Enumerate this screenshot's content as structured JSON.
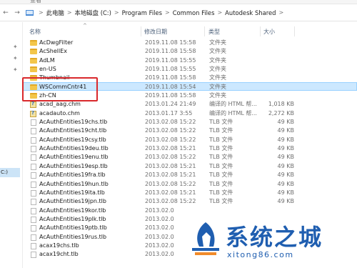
{
  "ribbon": {
    "partial_label": "查看"
  },
  "address": {
    "back_arrow": "←",
    "forward_arrow": "→",
    "crumbs": [
      "此电脑",
      "本地磁盘 (C:)",
      "Program Files",
      "Common Files",
      "Autodesk Shared"
    ],
    "separator": ">"
  },
  "nav": {
    "pin_glyph": "✦",
    "selected_item_partial": "C:)"
  },
  "columns": {
    "name": "名称",
    "date": "修改日期",
    "type": "类型",
    "size": "大小"
  },
  "files": [
    {
      "name": "AcDwgFilter",
      "date": "2019.11.08 15:58",
      "type": "文件夹",
      "size": "",
      "kind": "folder"
    },
    {
      "name": "AcShellEx",
      "date": "2019.11.08 15:58",
      "type": "文件夹",
      "size": "",
      "kind": "folder"
    },
    {
      "name": "AdLM",
      "date": "2019.11.08 15:55",
      "type": "文件夹",
      "size": "",
      "kind": "folder"
    },
    {
      "name": "en-US",
      "date": "2019.11.08 15:55",
      "type": "文件夹",
      "size": "",
      "kind": "folder"
    },
    {
      "name": "Thumbnail",
      "date": "2019.11.08 15:58",
      "type": "文件夹",
      "size": "",
      "kind": "folder"
    },
    {
      "name": "WSCommCntr41",
      "date": "2019.11.08 15:54",
      "type": "文件夹",
      "size": "",
      "kind": "folder",
      "selected": true
    },
    {
      "name": "zh-CN",
      "date": "2019.11.08 15:58",
      "type": "文件夹",
      "size": "",
      "kind": "folder"
    },
    {
      "name": "acad_aag.chm",
      "date": "2013.01.24 21:49",
      "type": "编译的 HTML 帮...",
      "size": "1,018 KB",
      "kind": "chm"
    },
    {
      "name": "acadauto.chm",
      "date": "2013.01.17 3:55",
      "type": "编译的 HTML 帮...",
      "size": "2,272 KB",
      "kind": "chm"
    },
    {
      "name": "AcAuthEntities19chs.tlb",
      "date": "2013.02.08 15:22",
      "type": "TLB 文件",
      "size": "49 KB",
      "kind": "tlb"
    },
    {
      "name": "AcAuthEntities19cht.tlb",
      "date": "2013.02.08 15:22",
      "type": "TLB 文件",
      "size": "49 KB",
      "kind": "tlb"
    },
    {
      "name": "AcAuthEntities19csy.tlb",
      "date": "2013.02.08 15:22",
      "type": "TLB 文件",
      "size": "49 KB",
      "kind": "tlb"
    },
    {
      "name": "AcAuthEntities19deu.tlb",
      "date": "2013.02.08 15:21",
      "type": "TLB 文件",
      "size": "49 KB",
      "kind": "tlb"
    },
    {
      "name": "AcAuthEntities19enu.tlb",
      "date": "2013.02.08 15:22",
      "type": "TLB 文件",
      "size": "49 KB",
      "kind": "tlb"
    },
    {
      "name": "AcAuthEntities19esp.tlb",
      "date": "2013.02.08 15:21",
      "type": "TLB 文件",
      "size": "49 KB",
      "kind": "tlb"
    },
    {
      "name": "AcAuthEntities19fra.tlb",
      "date": "2013.02.08 15:21",
      "type": "TLB 文件",
      "size": "49 KB",
      "kind": "tlb"
    },
    {
      "name": "AcAuthEntities19hun.tlb",
      "date": "2013.02.08 15:22",
      "type": "TLB 文件",
      "size": "49 KB",
      "kind": "tlb"
    },
    {
      "name": "AcAuthEntities19ita.tlb",
      "date": "2013.02.08 15:21",
      "type": "TLB 文件",
      "size": "49 KB",
      "kind": "tlb"
    },
    {
      "name": "AcAuthEntities19jpn.tlb",
      "date": "2013.02.08 15:22",
      "type": "TLB 文件",
      "size": "49 KB",
      "kind": "tlb"
    },
    {
      "name": "AcAuthEntities19kor.tlb",
      "date": "2013.02.0",
      "type": "",
      "size": "",
      "kind": "tlb"
    },
    {
      "name": "AcAuthEntities19plk.tlb",
      "date": "2013.02.0",
      "type": "",
      "size": "",
      "kind": "tlb"
    },
    {
      "name": "AcAuthEntities19ptb.tlb",
      "date": "2013.02.0",
      "type": "",
      "size": "",
      "kind": "tlb"
    },
    {
      "name": "AcAuthEntities19rus.tlb",
      "date": "2013.02.0",
      "type": "",
      "size": "",
      "kind": "tlb"
    },
    {
      "name": "acax19chs.tlb",
      "date": "2013.02.0",
      "type": "",
      "size": "",
      "kind": "tlb"
    },
    {
      "name": "acax19cht.tlb",
      "date": "2013.02.0",
      "type": "",
      "size": "",
      "kind": "tlb"
    }
  ],
  "watermark": {
    "brand": "系统之城",
    "url": "xitong86.com"
  },
  "colors": {
    "selection_fill": "#cce8ff",
    "selection_border": "#99d1ff",
    "highlight_box": "#d9282c",
    "folder": "#f3c64a",
    "watermark_blue": "#1f5eb0"
  }
}
